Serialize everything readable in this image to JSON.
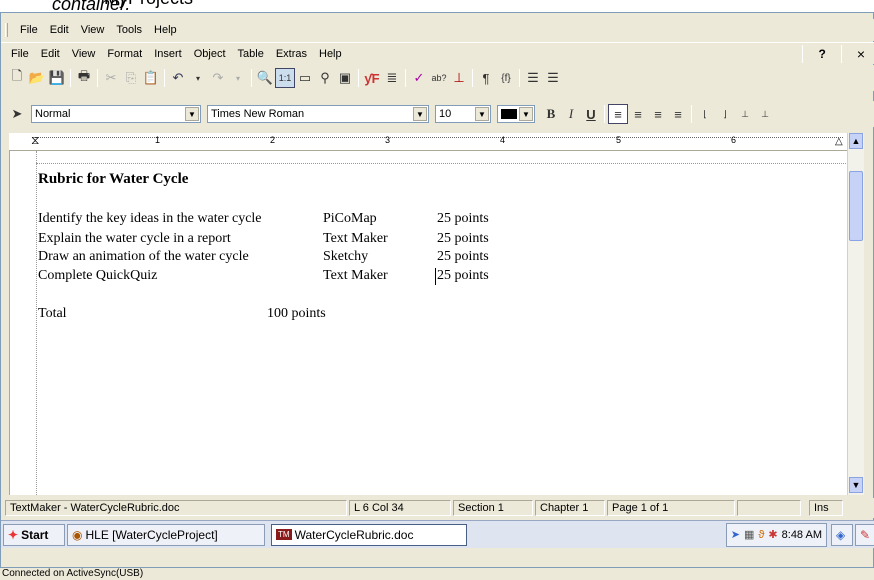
{
  "caption": {
    "prefix": "MyProjects ",
    "emph": "container."
  },
  "outer_menu": [
    "File",
    "Edit",
    "View",
    "Tools",
    "Help"
  ],
  "app_menu": [
    "File",
    "Edit",
    "View",
    "Format",
    "Insert",
    "Object",
    "Table",
    "Extras",
    "Help"
  ],
  "app_menu_right": {
    "help": "?",
    "close": "×"
  },
  "format_bar": {
    "style": "Normal",
    "font": "Times New Roman",
    "size": "10"
  },
  "ruler_numbers": [
    "1",
    "2",
    "3",
    "4",
    "5",
    "6"
  ],
  "document": {
    "title": "Rubric for Water Cycle",
    "rows": [
      {
        "task": "Identify the key ideas in the water cycle",
        "tool": "PiCoMap",
        "points": "25 points"
      },
      {
        "task": "Explain the water cycle in a report",
        "tool": "Text Maker",
        "points": "25 points"
      },
      {
        "task": "Draw an animation of the water cycle",
        "tool": "Sketchy",
        "points": "25 points"
      },
      {
        "task": "Complete QuickQuiz",
        "tool": "Text Maker",
        "points": "25 points"
      }
    ],
    "total_label": "Total",
    "total_value": "100 points"
  },
  "status": {
    "file": "TextMaker - WaterCycleRubric.doc",
    "position": "L 6 Col 34",
    "section": "Section 1",
    "chapter": "Chapter 1",
    "page": "Page 1 of 1",
    "mode": "Ins"
  },
  "taskbar": {
    "start": "Start",
    "items": [
      "HLE [WaterCycleProject]",
      "WaterCycleRubric.doc"
    ],
    "clock": "8:48 AM"
  },
  "connection": "Connected on ActiveSync(USB)"
}
